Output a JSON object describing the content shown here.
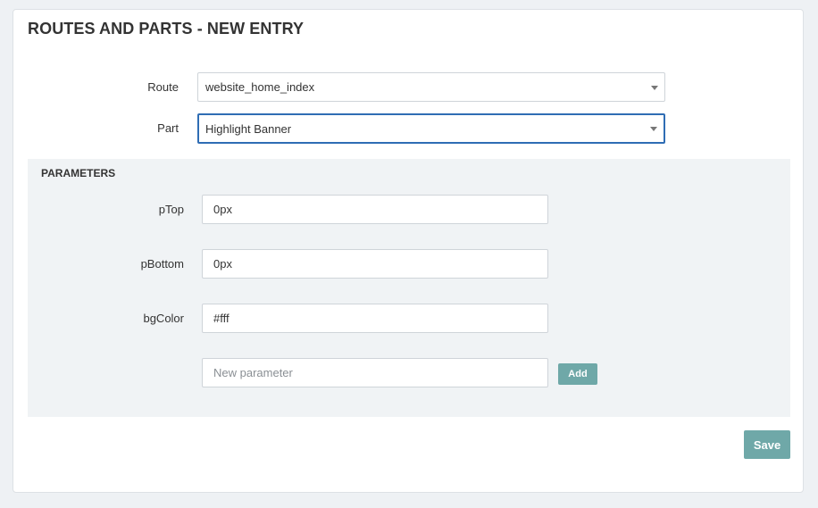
{
  "page": {
    "title": "ROUTES AND PARTS - NEW ENTRY"
  },
  "form": {
    "route": {
      "label": "Route",
      "value": "website_home_index"
    },
    "part": {
      "label": "Part",
      "value": "Highlight Banner"
    }
  },
  "parameters": {
    "title": "PARAMETERS",
    "items": [
      {
        "label": "pTop",
        "value": "0px"
      },
      {
        "label": "pBottom",
        "value": "0px"
      },
      {
        "label": "bgColor",
        "value": "#fff"
      }
    ],
    "new_placeholder": "New parameter",
    "add_label": "Add"
  },
  "actions": {
    "save_label": "Save"
  },
  "colors": {
    "accent": "#6fa8a8",
    "focus_border": "#2f6db4",
    "panel_bg": "#f0f3f5",
    "page_bg": "#eef1f4"
  },
  "icons": {
    "dropdown": "chevron-down-icon"
  }
}
